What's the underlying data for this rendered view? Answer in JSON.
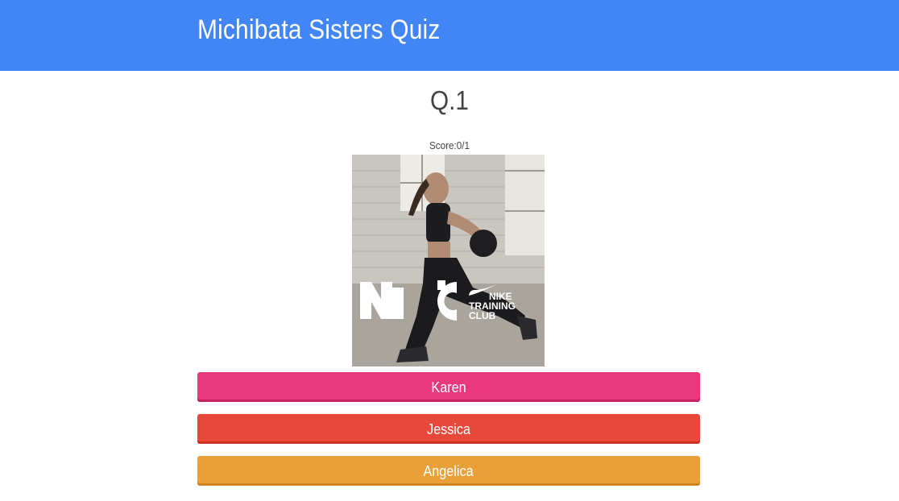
{
  "header": {
    "title": "Michibata Sisters Quiz"
  },
  "quiz": {
    "question_label": "Q.1",
    "score_text": "Score:0/1",
    "image": {
      "brand_line1": "NIKE",
      "brand_line2": "TRAINING",
      "brand_line3": "CLUB"
    },
    "answers": [
      {
        "label": "Karen",
        "color": "#e8397f"
      },
      {
        "label": "Jessica",
        "color": "#e8493b"
      },
      {
        "label": "Angelica",
        "color": "#e9a038"
      }
    ]
  },
  "colors": {
    "header": "#4285f4"
  }
}
